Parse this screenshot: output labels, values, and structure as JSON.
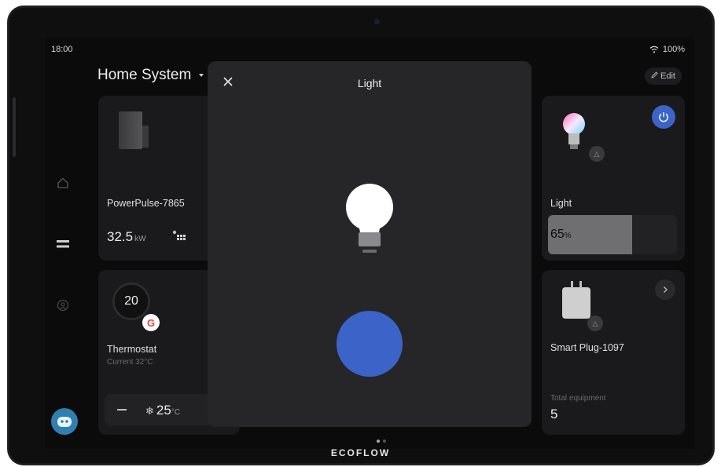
{
  "status": {
    "time": "18:00",
    "battery": "100%"
  },
  "header": {
    "title": "Home System",
    "edit_label": "Edit"
  },
  "nav": {
    "items": [
      "home-icon",
      "menu-icon",
      "profile-icon"
    ]
  },
  "cards": {
    "power": {
      "name": "PowerPulse-7865",
      "value": "32.5",
      "unit": "kW"
    },
    "thermostat": {
      "dial_value": "20",
      "name": "Thermostat",
      "current": "Current 32°C",
      "target": "25",
      "target_unit": "°C"
    },
    "light": {
      "name": "Light",
      "brightness": "65",
      "brightness_unit": "%",
      "brightness_level": 0.65
    },
    "plug": {
      "name": "Smart Plug-1097",
      "total_label": "Total equipment",
      "total_value": "5"
    }
  },
  "modal": {
    "title": "Light"
  },
  "brand": {
    "logo": "ECOFLOW"
  },
  "colors": {
    "accent": "#3b63c8",
    "card_bg": "#1a1a1c",
    "modal_bg": "#262628",
    "screen_bg": "#0b0b0c"
  }
}
